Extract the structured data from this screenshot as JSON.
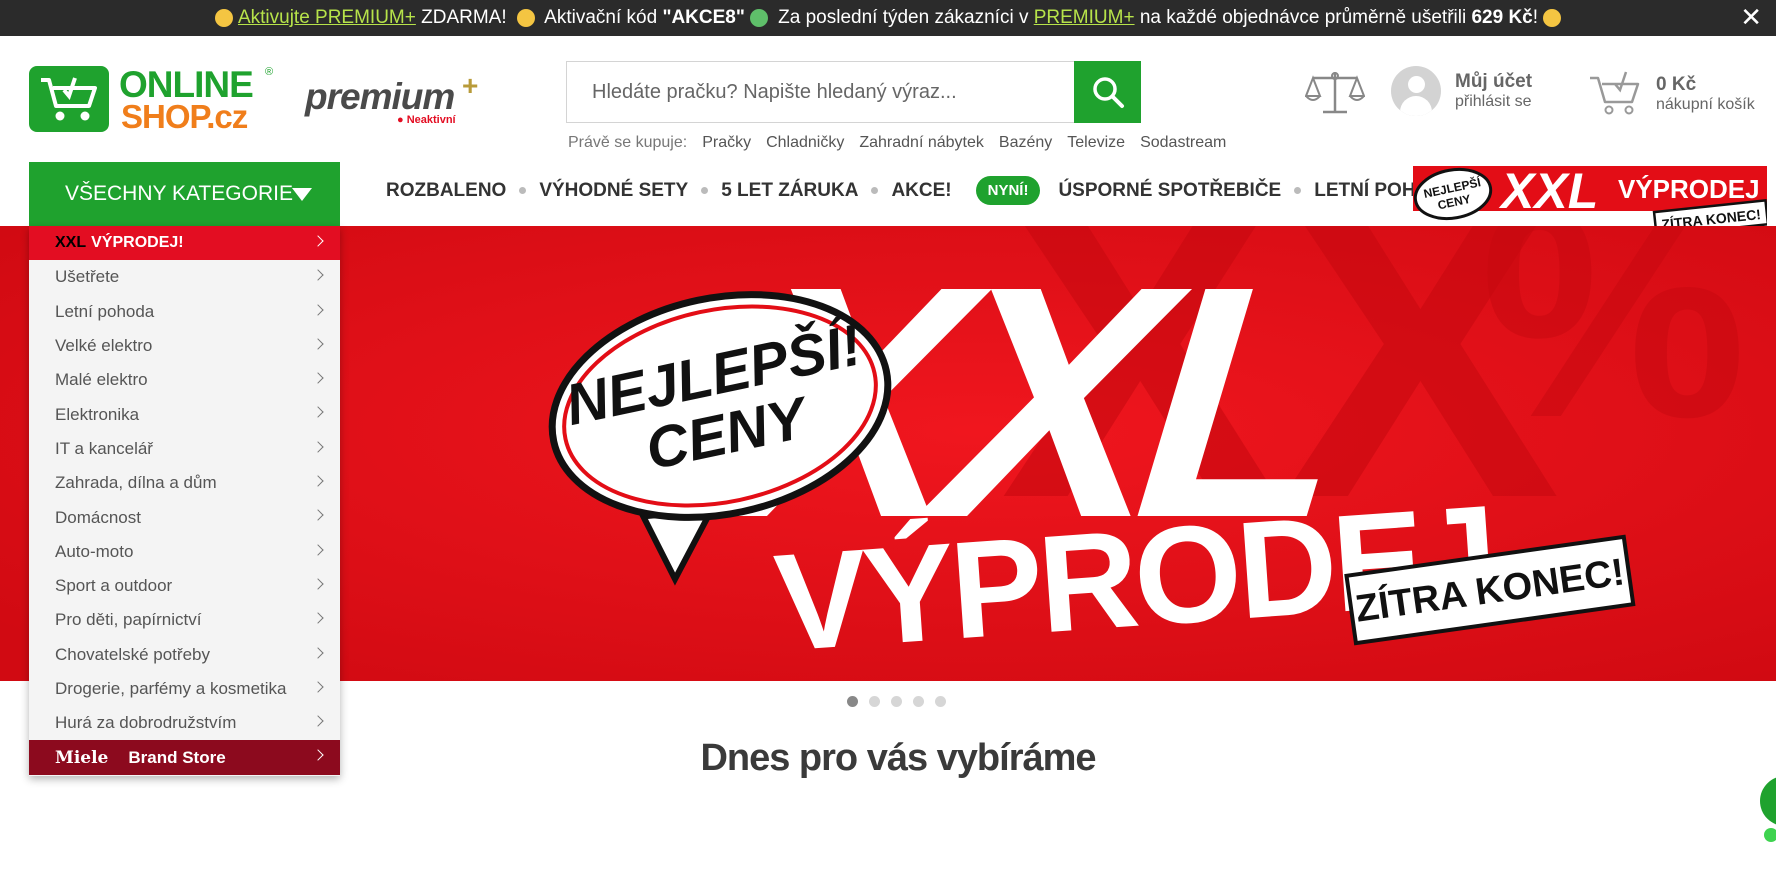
{
  "promo_bar": {
    "link1": "Aktivujte PREMIUM+",
    "text1": " ZDARMA! ",
    "text2": " Aktivační kód ",
    "code": "\"AKCE8\"",
    "text3": " Za poslední týden zákazníci v ",
    "link2": "PREMIUM+",
    "text4": " na každé objednávce průměrně ušetřili ",
    "amount": "629 Kč",
    "text5": "!",
    "close": "✕"
  },
  "logo": {
    "line1": "ONLINE",
    "line2": "SHOP.cz",
    "reg": "®"
  },
  "premium": {
    "word": "premium",
    "plus": "+",
    "status": "● Neaktivní"
  },
  "search": {
    "placeholder": "Hledáte pračku? Napište hledaný výraz..."
  },
  "popular": {
    "label": "Právě se kupuje:",
    "items": [
      "Pračky",
      "Chladničky",
      "Zahradní nábytek",
      "Bazény",
      "Televize",
      "Sodastream"
    ]
  },
  "account": {
    "title": "Můj účet",
    "subtitle": "přihlásit se"
  },
  "cart": {
    "total": "0 Kč",
    "subtitle": "nákupní košík"
  },
  "all_categories": "VŠECHNY KATEGORIE",
  "nav": {
    "items": [
      "ROZBALENO",
      "VÝHODNÉ SETY",
      "5 LET ZÁRUKA",
      "AKCE!"
    ],
    "badge": "NYNÍ!",
    "items2": [
      "ÚSPORNÉ SPOTŘEBIČE",
      "LETNÍ POHODA"
    ]
  },
  "nav_banner": {
    "bubble": "NEJLEPŠÍ CENY",
    "xxl": "XXL",
    "sale": "VÝPRODEJ",
    "tag": "ZÍTRA KONEC!"
  },
  "sidebar": {
    "xxl_prefix": "XXL",
    "xxl_label": "VÝPRODEJ!",
    "items": [
      "Ušetřete",
      "Letní pohoda",
      "Velké elektro",
      "Malé elektro",
      "Elektronika",
      "IT a kancelář",
      "Zahrada, dílna a dům",
      "Domácnost",
      "Auto-moto",
      "Sport a outdoor",
      "Pro děti, papírnictví",
      "Chovatelské potřeby",
      "Drogerie, parfémy a kosmetika",
      "Hurá za dobrodružstvím"
    ],
    "miele_logo": "Miele",
    "miele_label": "Brand Store"
  },
  "hero": {
    "bubble_line1": "NEJLEPŠÍ!",
    "bubble_line2": "CENY",
    "big": "XXL",
    "sale": "VÝPRODEJ",
    "tag": "ZÍTRA KONEC!"
  },
  "carousel": {
    "count": 5,
    "active": 1
  },
  "section_title": "Dnes pro vás vybíráme",
  "colors": {
    "brand_green": "#1fa22e",
    "brand_orange": "#f07e1b",
    "sale_red": "#e30d16",
    "miele_red": "#8c0a1e",
    "topbar": "#2b2b2b"
  }
}
